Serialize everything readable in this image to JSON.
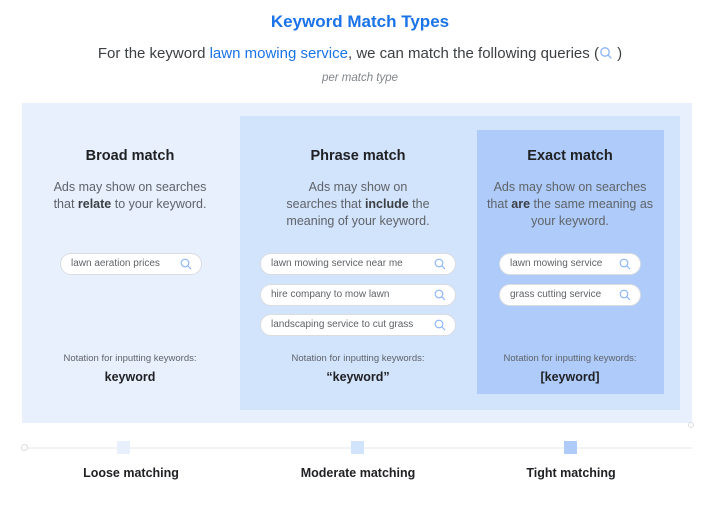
{
  "header": {
    "title": "Keyword Match Types",
    "subtitle_prefix": "For the keyword ",
    "subtitle_keyword": "lawn mowing service",
    "subtitle_suffix": ", we can match the following queries (",
    "subtitle_end": " )",
    "note": "per match type"
  },
  "colors": {
    "accent": "#1a73e8",
    "broad_bg": "#e8f0fe",
    "phrase_bg": "#d2e3fc",
    "exact_bg": "#aecbfa"
  },
  "match_types": [
    {
      "name": "Broad match",
      "desc_pre": "Ads may show on searches that ",
      "desc_bold": "relate",
      "desc_post": " to your keyword.",
      "queries": [
        "lawn aeration prices"
      ],
      "notation_label": "Notation for inputting keywords:",
      "notation": "keyword"
    },
    {
      "name": "Phrase match",
      "desc_pre": "Ads may show on searches that ",
      "desc_bold": "include",
      "desc_post": " the meaning of your keyword.",
      "queries": [
        "lawn mowing service near me",
        "hire company to mow lawn",
        "landscaping service to cut grass"
      ],
      "notation_label": "Notation for inputting keywords:",
      "notation": "“keyword”"
    },
    {
      "name": "Exact match",
      "desc_pre": "Ads may show on searches that ",
      "desc_bold": "are",
      "desc_post": " the same meaning as your keyword.",
      "queries": [
        "lawn mowing service",
        "grass cutting service"
      ],
      "notation_label": "Notation for inputting keywords:",
      "notation": "[keyword]"
    }
  ],
  "scale": {
    "labels": [
      "Loose matching",
      "Moderate matching",
      "Tight matching"
    ]
  }
}
